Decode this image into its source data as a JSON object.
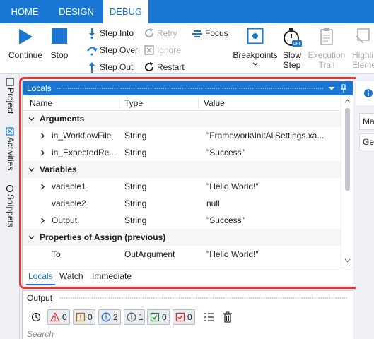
{
  "ribbon_tabs": [
    "HOME",
    "DESIGN",
    "DEBUG"
  ],
  "active_tab": "DEBUG",
  "toolbar": {
    "continue": "Continue",
    "stop": "Stop",
    "step_into": "Step Into",
    "step_over": "Step Over",
    "step_out": "Step Out",
    "retry": "Retry",
    "ignore": "Ignore",
    "restart": "Restart",
    "focus": "Focus",
    "breakpoints": "Breakpoints",
    "slow_step_1": "Slow",
    "slow_step_2": "Step",
    "slow_step_badge": "OFF",
    "execution_trail_1": "Execution",
    "execution_trail_2": "Trail",
    "highlight_1": "Highli",
    "highlight_2": "Eleme"
  },
  "side_panels": [
    "Project",
    "Activities",
    "Snippets"
  ],
  "locals": {
    "title": "Locals",
    "columns": [
      "Name",
      "Type",
      "Value"
    ],
    "rows": [
      {
        "kind": "group",
        "name": "Arguments"
      },
      {
        "kind": "item",
        "expandable": true,
        "name": "in_WorkflowFile",
        "type": "String",
        "value": "\"Framework\\InitAllSettings.xa..."
      },
      {
        "kind": "item",
        "expandable": true,
        "name": "in_ExpectedRe...",
        "type": "String",
        "value": "\"Success\""
      },
      {
        "kind": "group",
        "name": "Variables"
      },
      {
        "kind": "item",
        "expandable": true,
        "name": "variable1",
        "type": "String",
        "value": "\"Hello World!\""
      },
      {
        "kind": "item",
        "expandable": false,
        "name": "variable2",
        "type": "String",
        "value": "null"
      },
      {
        "kind": "item",
        "expandable": true,
        "name": "Output",
        "type": "String",
        "value": "\"Success\""
      },
      {
        "kind": "group",
        "name": "Properties of Assign (previous)"
      },
      {
        "kind": "item",
        "expandable": false,
        "name": "To",
        "type": "OutArgument",
        "value": "\"Hello World!\""
      },
      {
        "kind": "item",
        "expandable": false,
        "name": "Value",
        "type": "InArgument",
        "value": "\"Hello World!\""
      }
    ],
    "bottom_tabs": [
      "Locals",
      "Watch",
      "Immediate"
    ],
    "active_bottom_tab": "Locals"
  },
  "output": {
    "title": "Output",
    "filters": [
      {
        "icon": "error-icon",
        "count": "0",
        "color": "#d32f2f"
      },
      {
        "icon": "warning-icon",
        "count": "0",
        "color": "#b26a00"
      },
      {
        "icon": "info-icon",
        "count": "2",
        "color": "#1976d2"
      },
      {
        "icon": "trace-icon",
        "count": "1",
        "color": "#5f6368"
      },
      {
        "icon": "success-icon",
        "count": "0",
        "color": "#2e7d32"
      },
      {
        "icon": "fail-check-icon",
        "count": "0",
        "color": "#d32f2f"
      }
    ],
    "search_placeholder": "Search"
  },
  "right_panel": {
    "items": [
      "Ma",
      "Gen"
    ]
  },
  "colors": {
    "brand": "#1976d2",
    "highlight": "#e53935"
  }
}
